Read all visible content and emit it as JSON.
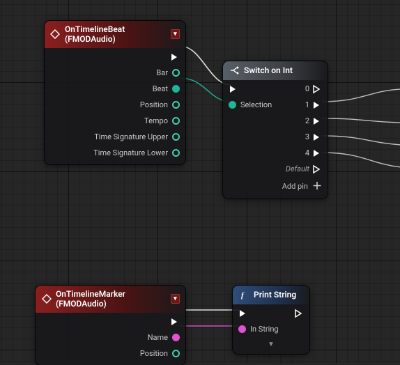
{
  "nodes": {
    "timelineBeat": {
      "title": "OnTimelineBeat (FMODAudio)",
      "outputs": {
        "bar": "Bar",
        "beat": "Beat",
        "position": "Position",
        "tempo": "Tempo",
        "tsu": "Time Signature Upper",
        "tsl": "Time Signature Lower"
      }
    },
    "switchInt": {
      "title": "Switch on Int",
      "inputs": {
        "selection": "Selection"
      },
      "outputs": {
        "o0": "0",
        "o1": "1",
        "o2": "2",
        "o3": "3",
        "o4": "4",
        "default": "Default"
      },
      "addPin": "Add pin"
    },
    "timelineMarker": {
      "title": "OnTimelineMarker (FMODAudio)",
      "outputs": {
        "name": "Name",
        "position": "Position"
      }
    },
    "printString": {
      "title": "Print String",
      "inputs": {
        "inString": "In String"
      }
    }
  }
}
